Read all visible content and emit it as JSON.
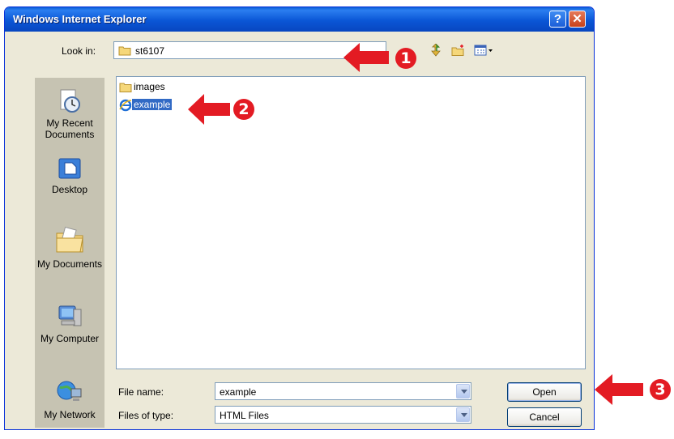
{
  "window": {
    "title": "Windows Internet Explorer",
    "help_label": "?",
    "close_label": "✕"
  },
  "lookin": {
    "label": "Look in:",
    "value": "st6107"
  },
  "toolbar": {
    "icons": [
      "up-one-level-icon",
      "new-folder-icon",
      "view-menu-icon"
    ]
  },
  "places": [
    {
      "label": "My Recent Documents",
      "icon": "recent-documents-icon"
    },
    {
      "label": "Desktop",
      "icon": "desktop-icon"
    },
    {
      "label": "My Documents",
      "icon": "my-documents-icon"
    },
    {
      "label": "My Computer",
      "icon": "my-computer-icon"
    },
    {
      "label": "My Network",
      "icon": "my-network-icon"
    }
  ],
  "files": [
    {
      "name": "images",
      "type": "folder",
      "selected": false
    },
    {
      "name": "example",
      "type": "html",
      "selected": true
    }
  ],
  "filename": {
    "label": "File name:",
    "value": "example"
  },
  "filetype": {
    "label": "Files of type:",
    "value": "HTML Files"
  },
  "buttons": {
    "open": "Open",
    "cancel": "Cancel"
  },
  "annotations": {
    "step1": "1",
    "step2": "2",
    "step3": "3",
    "color": "#e31b23"
  }
}
